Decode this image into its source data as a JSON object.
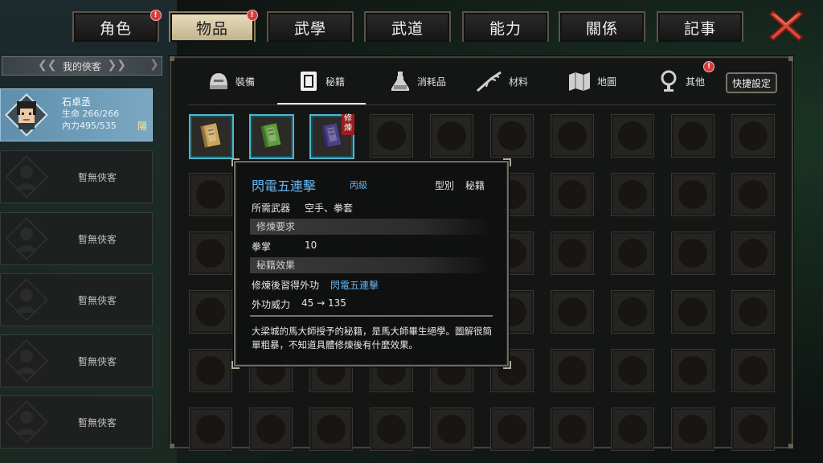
{
  "tabs": [
    {
      "label": "角色",
      "badge": true
    },
    {
      "label": "物品",
      "badge": true,
      "active": true
    },
    {
      "label": "武學",
      "badge": false
    },
    {
      "label": "武道",
      "badge": false
    },
    {
      "label": "能力",
      "badge": false
    },
    {
      "label": "關係",
      "badge": false
    },
    {
      "label": "記事",
      "badge": false
    }
  ],
  "badge_mark": "!",
  "followers": {
    "header": "我的俠客",
    "active": {
      "name": "石卓丞",
      "hp": "生命 266/266",
      "mp": "內力495/535",
      "tag": "陽"
    },
    "empty_label": "暫無俠客"
  },
  "categories": [
    {
      "label": "裝備",
      "icon": "helmet-icon"
    },
    {
      "label": "秘籍",
      "icon": "book-icon"
    },
    {
      "label": "消耗品",
      "icon": "potion-icon"
    },
    {
      "label": "材料",
      "icon": "herb-icon"
    },
    {
      "label": "地圖",
      "icon": "map-icon"
    },
    {
      "label": "其他",
      "icon": "lantern-icon",
      "badge": true
    }
  ],
  "quick_button": "快捷設定",
  "items": [
    {
      "name": "book-yellow",
      "color": "#c9a45a"
    },
    {
      "name": "book-green",
      "color": "#5f9c3f"
    },
    {
      "name": "book-purple",
      "color": "#4b3f8a",
      "tag": "修煉"
    }
  ],
  "tooltip": {
    "title": "閃電五連擊",
    "grade": "丙級",
    "type_label": "型別",
    "type_value": "秘籍",
    "weapon_label": "所需武器",
    "weapon_value": "空手、拳套",
    "req_section": "修煉要求",
    "req_label": "拳掌",
    "req_value": "10",
    "effect_section": "秘籍效果",
    "learn_label": "修煉後習得外功",
    "learn_value": "閃電五連擊",
    "power_label": "外功威力",
    "power_value": "45 → 135",
    "description": "大梁城的馬大師授予的秘籍，是馬大師畢生絕學。圖解很簡單粗暴，不知道具體修煉後有什麼效果。"
  },
  "colors": {
    "accent_blue": "#69b6ef",
    "slot_highlight": "#4fb6cc",
    "active_tab": "#e9dfc0",
    "close_red": "#d9493c"
  }
}
